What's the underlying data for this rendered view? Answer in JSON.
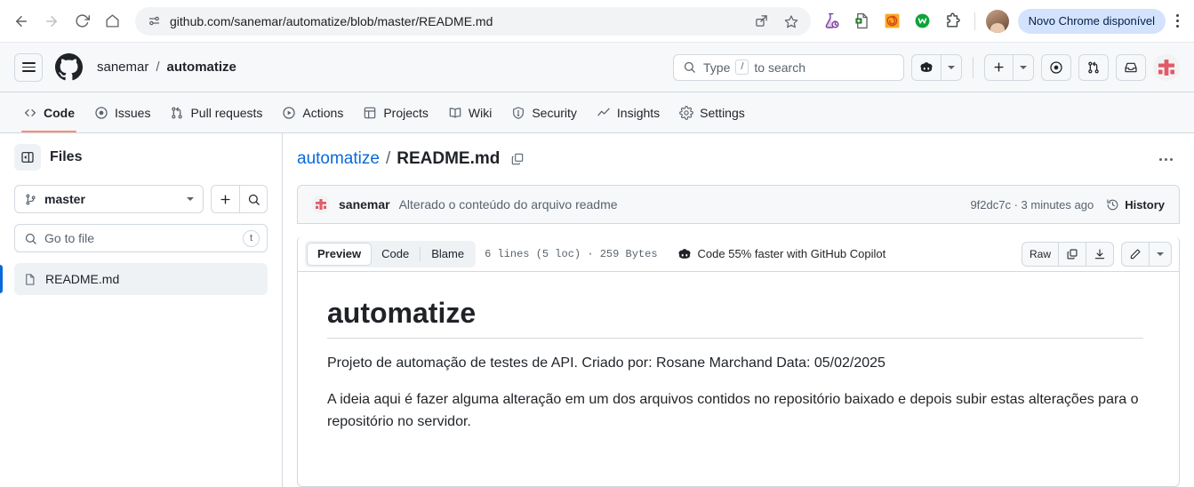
{
  "browser": {
    "back_icon": "arrow-left-icon",
    "forward_icon": "arrow-right-icon",
    "reload_icon": "reload-icon",
    "home_icon": "home-icon",
    "site_settings_icon": "site-settings-icon",
    "url": "github.com/sanemar/automatize/blob/master/README.md",
    "share_icon": "share-icon",
    "bookmark_icon": "star-icon",
    "extensions": [
      "flask-lab-icon",
      "document-add-icon",
      "spiral-orange-icon",
      "green-circle-w-icon",
      "puzzle-extensions-icon"
    ],
    "profile_icon": "profile-avatar",
    "update_pill": "Novo Chrome disponível",
    "menu_icon": "kebab-menu-icon"
  },
  "gh_header": {
    "hamburger_icon": "hamburger-menu-icon",
    "logo_icon": "github-logo-icon",
    "owner": "sanemar",
    "separator": "/",
    "repo": "automatize",
    "search": {
      "icon": "search-icon",
      "placeholder_before": "Type",
      "key": "/",
      "placeholder_after": "to search"
    },
    "copilot_icon": "copilot-icon",
    "plus_icon": "plus-icon",
    "issues_icon": "issue-opened-icon",
    "pulls_icon": "git-pull-request-icon",
    "inbox_icon": "inbox-icon",
    "avatar_icon": "user-avatar"
  },
  "repo_nav": {
    "tabs": [
      {
        "label": "Code",
        "icon": "code-icon",
        "active": true
      },
      {
        "label": "Issues",
        "icon": "issue-opened-icon",
        "active": false
      },
      {
        "label": "Pull requests",
        "icon": "git-pull-request-icon",
        "active": false
      },
      {
        "label": "Actions",
        "icon": "play-circle-icon",
        "active": false
      },
      {
        "label": "Projects",
        "icon": "table-icon",
        "active": false
      },
      {
        "label": "Wiki",
        "icon": "book-icon",
        "active": false
      },
      {
        "label": "Security",
        "icon": "shield-icon",
        "active": false
      },
      {
        "label": "Insights",
        "icon": "graph-icon",
        "active": false
      },
      {
        "label": "Settings",
        "icon": "gear-icon",
        "active": false
      }
    ]
  },
  "sidebar": {
    "toggle_icon": "sidebar-collapse-icon",
    "title": "Files",
    "branch": {
      "icon": "git-branch-icon",
      "name": "master"
    },
    "add_icon": "plus-icon",
    "search_icon": "search-icon",
    "go_to_file": {
      "icon": "search-icon",
      "placeholder": "Go to file",
      "shortcut": "t"
    },
    "files": [
      {
        "name": "README.md",
        "icon": "file-icon",
        "selected": true
      }
    ]
  },
  "file_header": {
    "repo_link": "automatize",
    "slash": "/",
    "filename": "README.md",
    "copy_path_icon": "copy-icon",
    "more_icon": "kebab-horizontal-icon"
  },
  "commit": {
    "avatar_icon": "user-avatar",
    "author": "sanemar",
    "message": "Alterado o conteúdo do arquivo readme",
    "sha_and_time": "9f2dc7c · 3 minutes ago",
    "history_icon": "history-icon",
    "history_label": "History"
  },
  "file_toolbar": {
    "tabs": [
      {
        "label": "Preview",
        "active": true
      },
      {
        "label": "Code",
        "active": false
      },
      {
        "label": "Blame",
        "active": false
      }
    ],
    "meta": "6 lines (5 loc) · 259 Bytes",
    "copilot_icon": "copilot-icon",
    "copilot_text": "Code 55% faster with GitHub Copilot",
    "raw_label": "Raw",
    "copy_icon": "copy-icon",
    "download_icon": "download-icon",
    "edit_icon": "pencil-icon",
    "dropdown_icon": "chevron-down-icon"
  },
  "readme": {
    "heading": "automatize",
    "paragraphs": [
      "Projeto de automação de testes de API. Criado por: Rosane Marchand Data: 05/02/2025",
      "A ideia aqui é fazer alguma alteração em um dos arquivos contidos no repositório baixado e depois subir estas alterações para o repositório no servidor."
    ]
  },
  "colors": {
    "accent_blue": "#0969da",
    "active_tab_underline": "#fd8c73",
    "border": "#d1d9e0",
    "header_bg": "#f6f8fa",
    "chrome_pill": "#d3e3fd"
  }
}
